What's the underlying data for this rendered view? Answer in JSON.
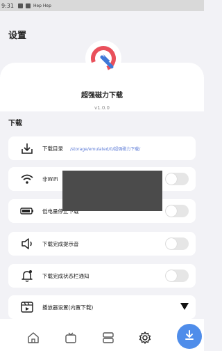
{
  "status_bar": {
    "time": "9:31",
    "app_text": "Hep Hep"
  },
  "header": {
    "title": "设置"
  },
  "app": {
    "name": "超强磁力下载",
    "version": "v1.0.0"
  },
  "section": {
    "title": "下载"
  },
  "settings": [
    {
      "label": "下载目录",
      "value": "/storage/emulated/0/超强磁力下载/",
      "icon": "download-tray-icon",
      "control": "path"
    },
    {
      "label": "非WiFi",
      "icon": "wifi-icon",
      "control": "toggle",
      "enabled": false
    },
    {
      "label": "低电量停止下载",
      "icon": "battery-icon",
      "control": "toggle",
      "enabled": false
    },
    {
      "label": "下载完成提示音",
      "icon": "speaker-icon",
      "control": "toggle",
      "enabled": false
    },
    {
      "label": "下载完成状态栏通知",
      "icon": "bell-icon",
      "control": "toggle",
      "enabled": false
    },
    {
      "label": "播放器设置(内置下载)",
      "icon": "player-icon",
      "control": "expand"
    }
  ],
  "bottom_nav": [
    {
      "icon": "home-icon"
    },
    {
      "icon": "tv-icon"
    },
    {
      "icon": "layers-icon"
    },
    {
      "icon": "gear-icon"
    },
    {
      "icon": "download-fab-icon"
    }
  ],
  "colors": {
    "accent": "#4f8dea",
    "path_text": "#5a79d6",
    "logo_red": "#e9505b",
    "logo_blue": "#3f78d8"
  }
}
